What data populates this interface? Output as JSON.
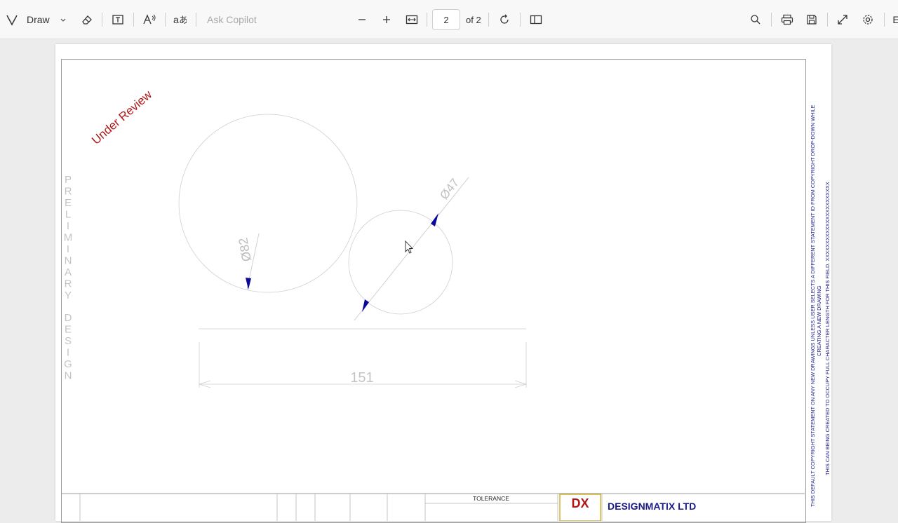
{
  "toolbar": {
    "draw_label": "Draw",
    "ask_copilot_placeholder": "Ask Copilot",
    "page_current": "2",
    "page_total": "of 2",
    "cut_label": "E"
  },
  "drawing": {
    "stamp": "Under Review",
    "watermark_word1": [
      "P",
      "R",
      "E",
      "L",
      "I",
      "M",
      "I",
      "N",
      "A",
      "R",
      "Y"
    ],
    "watermark_word2": [
      "D",
      "E",
      "S",
      "I",
      "G",
      "N"
    ],
    "dim_large_circle": "Ø82",
    "dim_small_circle": "Ø47",
    "dim_linear": "151",
    "copyright_line1": "THIS DEFAULT COPYRIGHT STATEMENT ON ANY NEW DRAWINGS UNLESS USER SELECTS A DIFFERENT STATEMENT ID FROM COPYRIGHT DROP-DOWN WHILE",
    "copyright_line2": "CREATING A NEW DRAWING",
    "copyright_line3": "THIS CAN BEING CREATED TO OCCUPY FULL CHARACTER LENGTH FOR THIS FIELD. XXXXXXXXXXXXXXXXXXXXXXX",
    "tolerance_label": "TOLERANCE",
    "company_name": "DESIGNMATIX LTD",
    "logo_text": "DX"
  },
  "colors": {
    "stamp": "#b01818",
    "arrow": "#0a0a9a",
    "copyright": "#1a1a8a",
    "dimension": "#b9b9b9"
  }
}
